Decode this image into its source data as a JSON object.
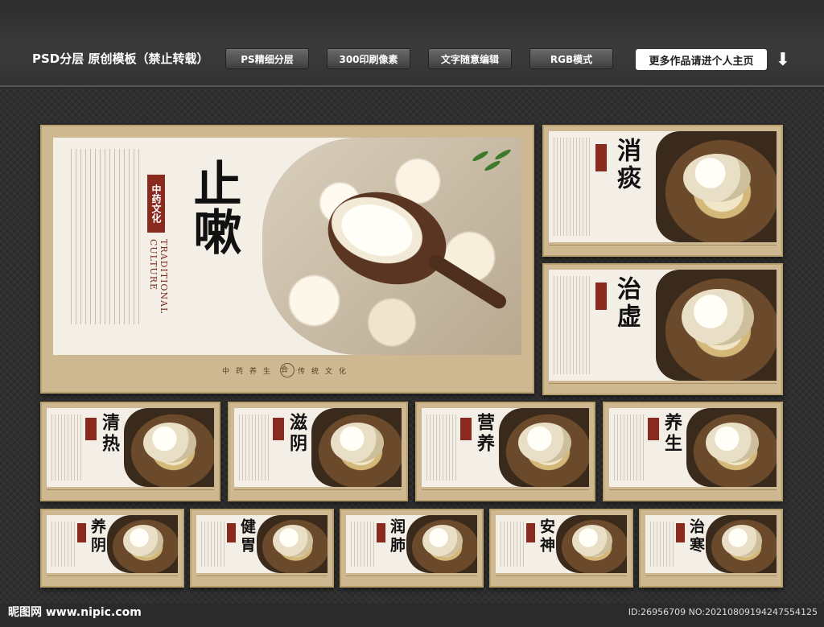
{
  "header": {
    "title": "PSD分层 原创模板（禁止转载）",
    "pills": [
      "PS精细分层",
      "300印刷像素",
      "文字随意编辑",
      "RGB模式"
    ],
    "cta": "更多作品请进个人主页"
  },
  "main_panel": {
    "badge": "中药文化",
    "culture": "TRADITIONAL CULTURE",
    "big_text": "止嗽",
    "footer": [
      "中",
      "药",
      "养",
      "生",
      "合",
      "传",
      "统",
      "文",
      "化"
    ]
  },
  "panels": [
    {
      "title": "消痰"
    },
    {
      "title": "治虚"
    },
    {
      "title": "清热"
    },
    {
      "title": "滋阴"
    },
    {
      "title": "营养"
    },
    {
      "title": "养生"
    },
    {
      "title": "养阴"
    },
    {
      "title": "健胃"
    },
    {
      "title": "润肺"
    },
    {
      "title": "安神"
    },
    {
      "title": "治寒"
    }
  ],
  "footer": {
    "site": "昵图网 www.nipic.com",
    "id": "ID:26956709 NO:20210809194247554125"
  }
}
